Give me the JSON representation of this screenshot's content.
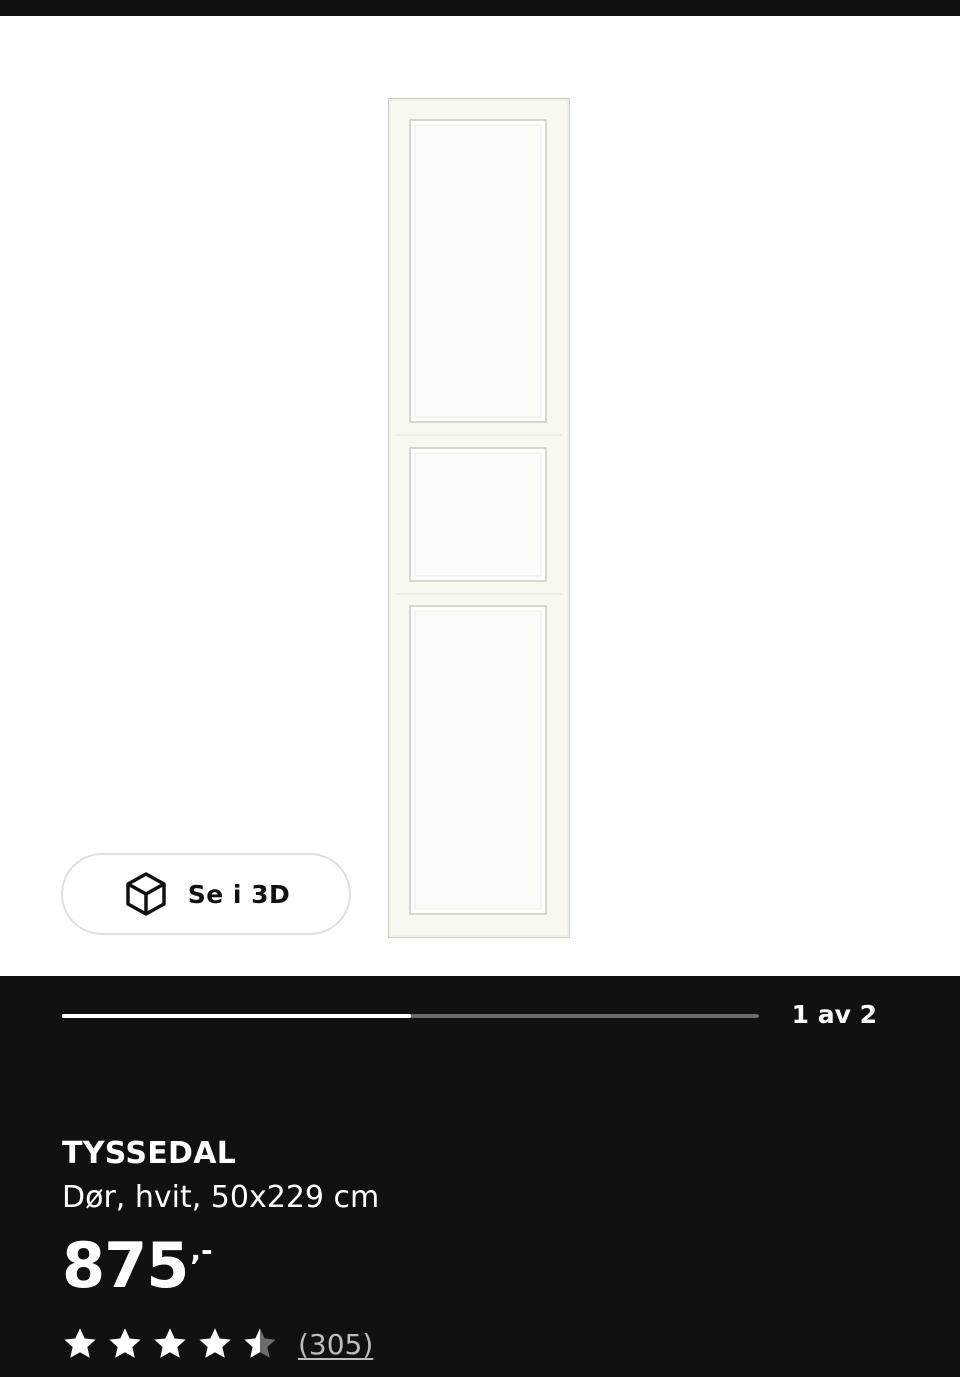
{
  "gallery": {
    "image_alt": "TYSSEDAL Dør, hvit",
    "view_3d_label": "Se i 3D",
    "view_3d_icon": "cube-icon",
    "progress_fraction": 0.5,
    "page_indicator": "1 av 2"
  },
  "product": {
    "name": "TYSSEDAL",
    "description": "Dør, hvit, 50x229 cm",
    "price_integer": "875",
    "price_decimals": ",-",
    "rating": {
      "value": 4.5,
      "max": 5,
      "review_count": "(305)",
      "star_icon": "star-icon",
      "half_star_icon": "half-star-icon"
    }
  },
  "colors": {
    "background": "#111111",
    "text": "#ffffff",
    "muted_text": "#bdbdbd",
    "progress_track": "#6b6b6b",
    "progress_fill": "#ffffff",
    "door_white": "#f7f6ef",
    "star_filled": "#ffffff",
    "star_empty": "#6b6b6b"
  }
}
